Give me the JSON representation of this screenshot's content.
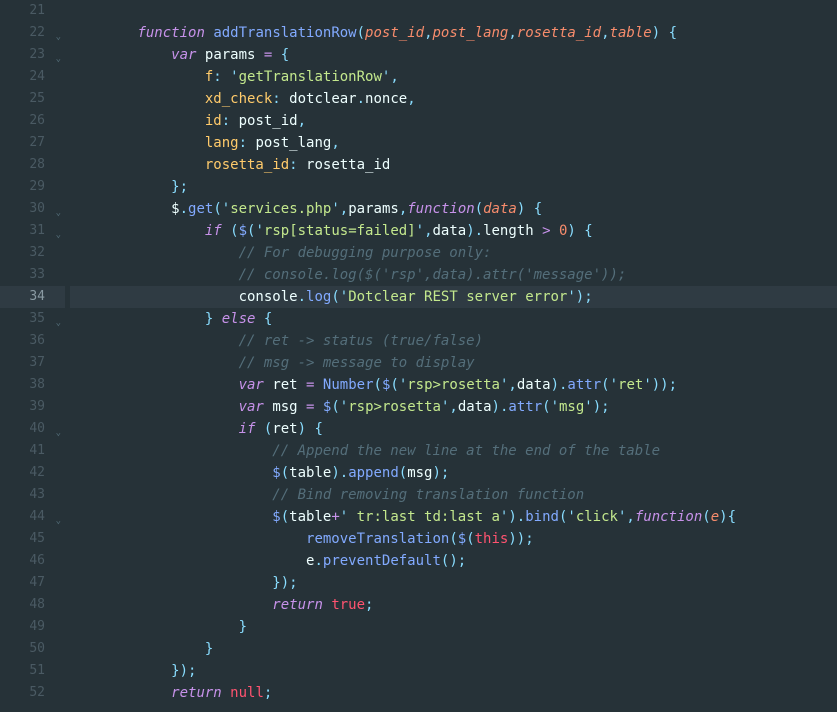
{
  "lines": [
    {
      "num": "21",
      "fold": "",
      "code": ""
    },
    {
      "num": "22",
      "fold": "v",
      "code": "        <span class='kw'>function</span> <span class='fn'>addTranslationRow</span><span class='punc'>(</span><span class='param'>post_id</span><span class='punc'>,</span><span class='param'>post_lang</span><span class='punc'>,</span><span class='param'>rosetta_id</span><span class='punc'>,</span><span class='param'>table</span><span class='punc'>)</span> <span class='punc'>{</span>"
    },
    {
      "num": "23",
      "fold": "v",
      "code": "            <span class='kw'>var</span> <span class='var'>params</span> <span class='op'>=</span> <span class='punc'>{</span>"
    },
    {
      "num": "24",
      "fold": "",
      "code": "                <span class='propkey'>f</span><span class='punc'>:</span> <span class='punc'>'</span><span class='str'>getTranslationRow</span><span class='punc'>'</span><span class='punc'>,</span>"
    },
    {
      "num": "25",
      "fold": "",
      "code": "                <span class='propkey'>xd_check</span><span class='punc'>:</span> <span class='var'>dotclear</span><span class='punc'>.</span><span class='var'>nonce</span><span class='punc'>,</span>"
    },
    {
      "num": "26",
      "fold": "",
      "code": "                <span class='propkey'>id</span><span class='punc'>:</span> <span class='var'>post_id</span><span class='punc'>,</span>"
    },
    {
      "num": "27",
      "fold": "",
      "code": "                <span class='propkey'>lang</span><span class='punc'>:</span> <span class='var'>post_lang</span><span class='punc'>,</span>"
    },
    {
      "num": "28",
      "fold": "",
      "code": "                <span class='propkey'>rosetta_id</span><span class='punc'>:</span> <span class='var'>rosetta_id</span>"
    },
    {
      "num": "29",
      "fold": "",
      "code": "            <span class='punc'>};</span>"
    },
    {
      "num": "30",
      "fold": "v",
      "code": "            <span class='var'>$</span><span class='punc'>.</span><span class='call'>get</span><span class='punc'>(</span><span class='punc'>'</span><span class='str'>services.php</span><span class='punc'>'</span><span class='punc'>,</span><span class='var'>params</span><span class='punc'>,</span><span class='kw'>function</span><span class='punc'>(</span><span class='param'>data</span><span class='punc'>)</span> <span class='punc'>{</span>"
    },
    {
      "num": "31",
      "fold": "v",
      "code": "                <span class='kw'>if</span> <span class='punc'>(</span><span class='call'>$</span><span class='punc'>(</span><span class='punc'>'</span><span class='str'>rsp[status=failed]</span><span class='punc'>'</span><span class='punc'>,</span><span class='var'>data</span><span class='punc'>).</span><span class='var'>length</span> <span class='op'>&gt;</span> <span class='num'>0</span><span class='punc'>)</span> <span class='punc'>{</span>"
    },
    {
      "num": "32",
      "fold": "",
      "code": "                    <span class='cmt'>// For debugging purpose only:</span>"
    },
    {
      "num": "33",
      "fold": "",
      "code": "                    <span class='cmt'>// console.log($('rsp',data).attr('message'));</span>"
    },
    {
      "num": "34",
      "fold": "",
      "highlight": true,
      "indent": true,
      "code": "                    <span class='var'>console</span><span class='punc'>.</span><span class='call'>log</span><span class='punc'>(</span><span class='punc'>'</span><span class='str'>Dotclear REST server error</span><span class='punc'>'</span><span class='punc'>);</span>"
    },
    {
      "num": "35",
      "fold": "v",
      "code": "                <span class='punc'>}</span> <span class='kw'>else</span> <span class='punc'>{</span>"
    },
    {
      "num": "36",
      "fold": "",
      "code": "                    <span class='cmt'>// ret -&gt; status (true/false)</span>"
    },
    {
      "num": "37",
      "fold": "",
      "code": "                    <span class='cmt'>// msg -&gt; message to display</span>"
    },
    {
      "num": "38",
      "fold": "",
      "code": "                    <span class='kw'>var</span> <span class='var'>ret</span> <span class='op'>=</span> <span class='call'>Number</span><span class='punc'>(</span><span class='call'>$</span><span class='punc'>(</span><span class='punc'>'</span><span class='str'>rsp&gt;rosetta</span><span class='punc'>'</span><span class='punc'>,</span><span class='var'>data</span><span class='punc'>).</span><span class='call'>attr</span><span class='punc'>(</span><span class='punc'>'</span><span class='str'>ret</span><span class='punc'>'</span><span class='punc'>));</span>"
    },
    {
      "num": "39",
      "fold": "",
      "code": "                    <span class='kw'>var</span> <span class='var'>msg</span> <span class='op'>=</span> <span class='call'>$</span><span class='punc'>(</span><span class='punc'>'</span><span class='str'>rsp&gt;rosetta</span><span class='punc'>'</span><span class='punc'>,</span><span class='var'>data</span><span class='punc'>).</span><span class='call'>attr</span><span class='punc'>(</span><span class='punc'>'</span><span class='str'>msg</span><span class='punc'>'</span><span class='punc'>);</span>"
    },
    {
      "num": "40",
      "fold": "v",
      "code": "                    <span class='kw'>if</span> <span class='punc'>(</span><span class='var'>ret</span><span class='punc'>)</span> <span class='punc'>{</span>"
    },
    {
      "num": "41",
      "fold": "",
      "code": "                        <span class='cmt'>// Append the new line at the end of the table</span>"
    },
    {
      "num": "42",
      "fold": "",
      "code": "                        <span class='call'>$</span><span class='punc'>(</span><span class='var'>table</span><span class='punc'>).</span><span class='call'>append</span><span class='punc'>(</span><span class='var'>msg</span><span class='punc'>);</span>"
    },
    {
      "num": "43",
      "fold": "",
      "code": "                        <span class='cmt'>// Bind removing translation function</span>"
    },
    {
      "num": "44",
      "fold": "v",
      "code": "                        <span class='call'>$</span><span class='punc'>(</span><span class='var'>table</span><span class='op'>+</span><span class='punc'>'</span><span class='str'> tr:last td:last a</span><span class='punc'>'</span><span class='punc'>).</span><span class='call'>bind</span><span class='punc'>(</span><span class='punc'>'</span><span class='str'>click</span><span class='punc'>'</span><span class='punc'>,</span><span class='kw'>function</span><span class='punc'>(</span><span class='param'>e</span><span class='punc'>){</span>"
    },
    {
      "num": "45",
      "fold": "",
      "code": "                            <span class='call'>removeTranslation</span><span class='punc'>(</span><span class='call'>$</span><span class='punc'>(</span><span class='bool'>this</span><span class='punc'>));</span>"
    },
    {
      "num": "46",
      "fold": "",
      "code": "                            <span class='var'>e</span><span class='punc'>.</span><span class='call'>preventDefault</span><span class='punc'>();</span>"
    },
    {
      "num": "47",
      "fold": "",
      "code": "                        <span class='punc'>});</span>"
    },
    {
      "num": "48",
      "fold": "",
      "code": "                        <span class='kw'>return</span> <span class='bool'>true</span><span class='punc'>;</span>"
    },
    {
      "num": "49",
      "fold": "",
      "code": "                    <span class='punc'>}</span>"
    },
    {
      "num": "50",
      "fold": "",
      "code": "                <span class='punc'>}</span>"
    },
    {
      "num": "51",
      "fold": "",
      "code": "            <span class='punc'>});</span>"
    },
    {
      "num": "52",
      "fold": "",
      "code": "            <span class='kw'>return</span> <span class='bool'>null</span><span class='punc'>;</span>"
    }
  ]
}
